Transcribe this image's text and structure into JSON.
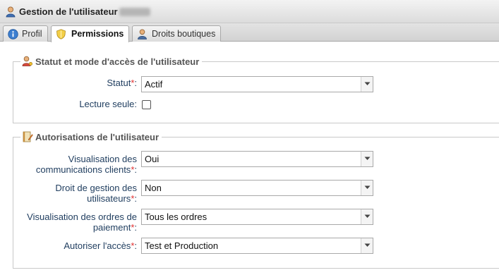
{
  "window": {
    "title": "Gestion de l'utilisateur"
  },
  "tabs": [
    {
      "label": "Profil",
      "icon": "info-icon",
      "active": false
    },
    {
      "label": "Permissions",
      "icon": "shield-icon",
      "active": true
    },
    {
      "label": "Droits boutiques",
      "icon": "user-icon",
      "active": false
    }
  ],
  "section_status": {
    "legend": "Statut et mode d'accès de l'utilisateur",
    "icon": "user-key-icon",
    "statut_label": "Statut",
    "statut_value": "Actif",
    "readonly_label": "Lecture seule:",
    "readonly_checked": false
  },
  "section_auth": {
    "legend": "Autorisations de l'utilisateur",
    "icon": "notebook-edit-icon",
    "fields": [
      {
        "label_line1": "Visualisation des",
        "label_line2": "communications clients",
        "value": "Oui"
      },
      {
        "label_line1": "Droit de gestion des",
        "label_line2": "utilisateurs",
        "value": "Non"
      },
      {
        "label_line1": "Visualisation des ordres de",
        "label_line2": "paiement",
        "value": "Tous les ordres"
      },
      {
        "label_line1": "Autoriser l'accès",
        "value": "Test et Production"
      }
    ]
  },
  "required_marker": "*",
  "colon": ":",
  "colors": {
    "label": "#1e3c5e",
    "required": "#e03030",
    "border": "#c8c8c8"
  }
}
